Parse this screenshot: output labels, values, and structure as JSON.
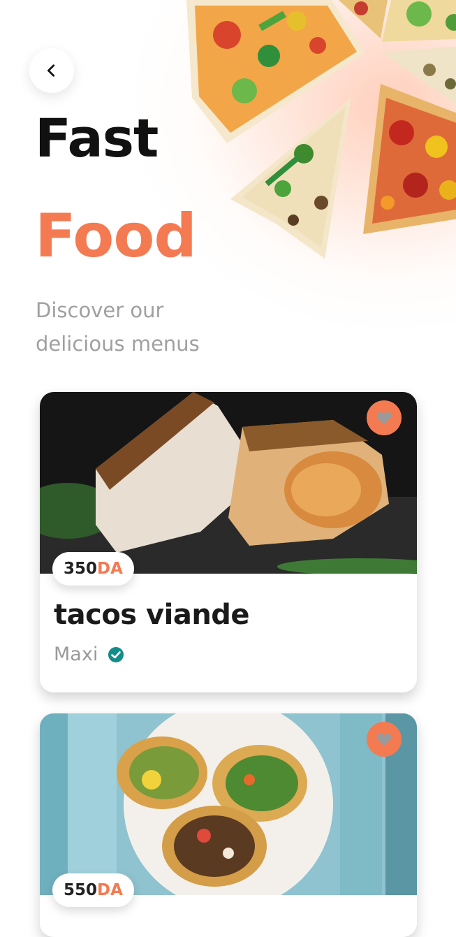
{
  "header": {
    "back_icon": "chevron-left-icon",
    "title_line1": "Fast",
    "title_line2": "Food",
    "subtitle": "Discover our delicious menus"
  },
  "colors": {
    "accent": "#f47a52",
    "title": "#111111",
    "muted": "#a0a0a0",
    "verified": "#138d8a"
  },
  "items": [
    {
      "name": "tacos viande",
      "price": "350",
      "currency": "DA",
      "size": "Maxi",
      "verified_icon": "check-circle-icon",
      "favorite_icon": "heart-icon"
    },
    {
      "price": "550",
      "currency": "DA",
      "favorite_icon": "heart-icon"
    }
  ]
}
